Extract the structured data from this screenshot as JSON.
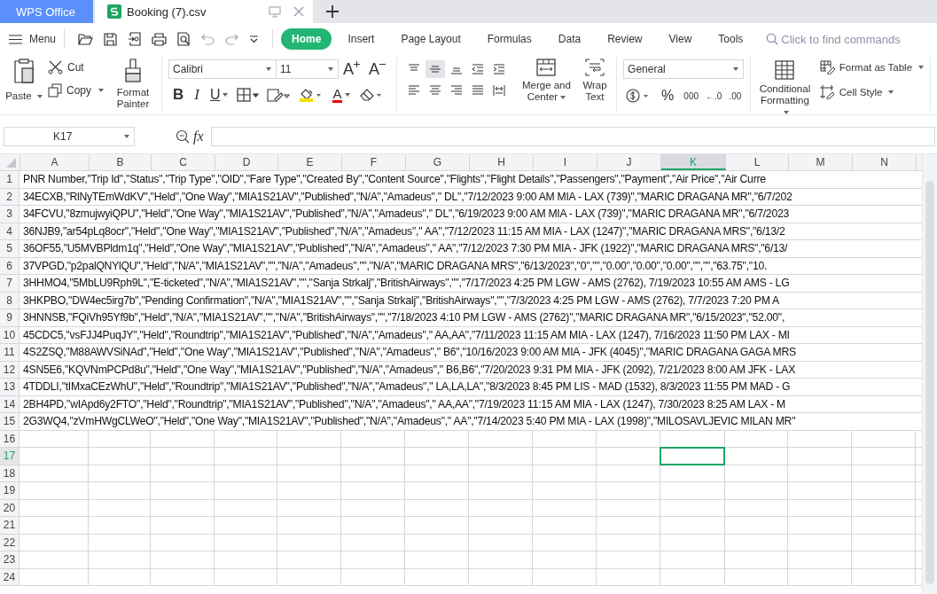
{
  "app_tab": {
    "label": "WPS Office"
  },
  "doc_tabs": [
    {
      "label": "Booking (7).csv",
      "selected": true
    }
  ],
  "menu": {
    "label": "Menu"
  },
  "ribbon_tabs": [
    {
      "label": "Home",
      "selected": true
    },
    {
      "label": "Insert",
      "selected": false
    },
    {
      "label": "Page Layout",
      "selected": false
    },
    {
      "label": "Formulas",
      "selected": false
    },
    {
      "label": "Data",
      "selected": false
    },
    {
      "label": "Review",
      "selected": false
    },
    {
      "label": "View",
      "selected": false
    },
    {
      "label": "Tools",
      "selected": false
    }
  ],
  "search": {
    "placeholder": "Click to find commands"
  },
  "ribbon": {
    "paste": "Paste",
    "cut": "Cut",
    "copy": "Copy",
    "format_painter": "Format Painter",
    "font": "Calibri",
    "font_size": "11",
    "grow_font": "A",
    "shrink_font": "A",
    "bold": "B",
    "italic": "I",
    "underline": "U",
    "font_color": "A",
    "merge": "Merge and Center",
    "wrap": "Wrap Text",
    "number_format": "General",
    "percent": "%",
    "thousands": "000",
    "decrease_decimal": "←.0",
    "increase_decimal": ".00",
    "conditional": "Conditional Formatting",
    "format_table": "Format as Table",
    "cell_style": "Cell Style"
  },
  "formula_bar": {
    "name_box": "K17",
    "fx": "fx"
  },
  "columns": [
    {
      "label": "A",
      "selected": false
    },
    {
      "label": "B",
      "selected": false
    },
    {
      "label": "C",
      "selected": false
    },
    {
      "label": "D",
      "selected": false
    },
    {
      "label": "E",
      "selected": false
    },
    {
      "label": "F",
      "selected": false
    },
    {
      "label": "G",
      "selected": false
    },
    {
      "label": "H",
      "selected": false
    },
    {
      "label": "I",
      "selected": false
    },
    {
      "label": "J",
      "selected": false
    },
    {
      "label": "K",
      "selected": true
    },
    {
      "label": "L",
      "selected": false
    },
    {
      "label": "M",
      "selected": false
    },
    {
      "label": "N",
      "selected": false
    }
  ],
  "rows": [
    {
      "number": "1",
      "selected": false,
      "text": "PNR Number,\"Trip Id\",\"Status\",\"Trip Type\",\"OID\",\"Fare Type\",\"Created By\",\"Content Source\",\"Flights\",\"Flight Details\",\"Passengers\",\"Payment\",\"Air Price\",\"Air Curre"
    },
    {
      "number": "2",
      "selected": false,
      "text": "34ECXB,\"RlNyTEmWdKV\",\"Held\",\"One Way\",\"MIA1S21AV\",\"Published\",\"N/A\",\"Amadeus\",\" DL\",\"7/12/2023 9:00 AM MIA - LAX (739)\",\"MARIC DRAGANA MR\",\"6/7/202"
    },
    {
      "number": "3",
      "selected": false,
      "text": "34FCVU,\"8zmujwyiQPU\",\"Held\",\"One Way\",\"MIA1S21AV\",\"Published\",\"N/A\",\"Amadeus\",\" DL\",\"6/19/2023 9:00 AM MIA - LAX (739)\",\"MARIC DRAGANA MR\",\"6/7/2023"
    },
    {
      "number": "4",
      "selected": false,
      "text": "36NJB9,\"ar54pLq8ocr\",\"Held\",\"One Way\",\"MIA1S21AV\",\"Published\",\"N/A\",\"Amadeus\",\" AA\",\"7/12/2023 11:15 AM MIA - LAX (1247)\",\"MARIC DRAGANA MRS\",\"6/13/2"
    },
    {
      "number": "5",
      "selected": false,
      "text": "36OF55,\"U5MVBPldm1q\",\"Held\",\"One Way\",\"MIA1S21AV\",\"Published\",\"N/A\",\"Amadeus\",\" AA\",\"7/12/2023 7:30 PM MIA - JFK (1922)\",\"MARIC DRAGANA MRS\",\"6/13/"
    },
    {
      "number": "6",
      "selected": false,
      "text": "37VPGD,\"p2palQNYlQU\",\"Held\",\"N/A\",\"MIA1S21AV\",\"\",\"N/A\",\"Amadeus\",\"\",\"N/A\",\"MARIC DRAGANA MRS\",\"6/13/2023\",\"0\",\"\",\"0.00\",\"0.00\",\"0.00\",\"\",\"\",\"63.75\",\"10."
    },
    {
      "number": "7",
      "selected": false,
      "text": "3HHMO4,\"5MbLU9Rph9L\",\"E-ticketed\",\"N/A\",\"MIA1S21AV\",\"\",\"Sanja Strkalj\",\"BritishAirways\",\"\",\"7/17/2023 4:25 PM LGW - AMS (2762), 7/19/2023 10:55 AM AMS - LG"
    },
    {
      "number": "8",
      "selected": false,
      "text": "3HKPBO,\"DW4ec5irg7b\",\"Pending Confirmation\",\"N/A\",\"MIA1S21AV\",\"\",\"Sanja Strkalj\",\"BritishAirways\",\"\",\"7/3/2023 4:25 PM LGW - AMS (2762), 7/7/2023 7:20 PM A"
    },
    {
      "number": "9",
      "selected": false,
      "text": "3HNNSB,\"FQiVh95Yf9b\",\"Held\",\"N/A\",\"MIA1S21AV\",\"\",\"N/A\",\"BritishAirways\",\"\",\"7/18/2023 4:10 PM LGW - AMS (2762)\",\"MARIC DRAGANA MR\",\"6/15/2023\",\"52.00\","
    },
    {
      "number": "10",
      "selected": false,
      "text": "45CDC5,\"vsFJJ4PuqJY\",\"Held\",\"Roundtrip\",\"MIA1S21AV\",\"Published\",\"N/A\",\"Amadeus\",\" AA,AA\",\"7/11/2023 11:15 AM MIA - LAX (1247), 7/16/2023 11:50 PM LAX - MI"
    },
    {
      "number": "11",
      "selected": false,
      "text": "4S2ZSQ,\"M88AWVSiNAd\",\"Held\",\"One Way\",\"MIA1S21AV\",\"Published\",\"N/A\",\"Amadeus\",\" B6\",\"10/16/2023 9:00 AM MIA - JFK (4045)\",\"MARIC DRAGANA GAGA MRS"
    },
    {
      "number": "12",
      "selected": false,
      "text": "4SN5E6,\"KQVNmPCPd8u\",\"Held\",\"One Way\",\"MIA1S21AV\",\"Published\",\"N/A\",\"Amadeus\",\" B6,B6\",\"7/20/2023 9:31 PM MIA - JFK (2092), 7/21/2023 8:00 AM JFK - LAX"
    },
    {
      "number": "13",
      "selected": false,
      "text": "4TDDLI,\"tIMxaCEzWhU\",\"Held\",\"Roundtrip\",\"MIA1S21AV\",\"Published\",\"N/A\",\"Amadeus\",\" LA,LA,LA\",\"8/3/2023 8:45 PM LIS - MAD (1532), 8/3/2023 11:55 PM MAD - G"
    },
    {
      "number": "14",
      "selected": false,
      "text": "2BH4PD,\"wIApd6y2FTO\",\"Held\",\"Roundtrip\",\"MIA1S21AV\",\"Published\",\"N/A\",\"Amadeus\",\" AA,AA\",\"7/19/2023 11:15 AM MIA - LAX (1247), 7/30/2023 8:25 AM LAX - M"
    },
    {
      "number": "15",
      "selected": false,
      "text": "2G3WQ4,\"zVmHWgCLWeO\",\"Held\",\"One Way\",\"MIA1S21AV\",\"Published\",\"N/A\",\"Amadeus\",\" AA\",\"7/14/2023 5:40 PM MIA - LAX (1998)\",\"MILOSAVLJEVIC MILAN MR\""
    },
    {
      "number": "16",
      "selected": false
    },
    {
      "number": "17",
      "selected": true
    },
    {
      "number": "18",
      "selected": false
    },
    {
      "number": "19",
      "selected": false
    },
    {
      "number": "20",
      "selected": false
    },
    {
      "number": "21",
      "selected": false
    },
    {
      "number": "22",
      "selected": false
    },
    {
      "number": "23",
      "selected": false
    },
    {
      "number": "24",
      "selected": false
    }
  ]
}
